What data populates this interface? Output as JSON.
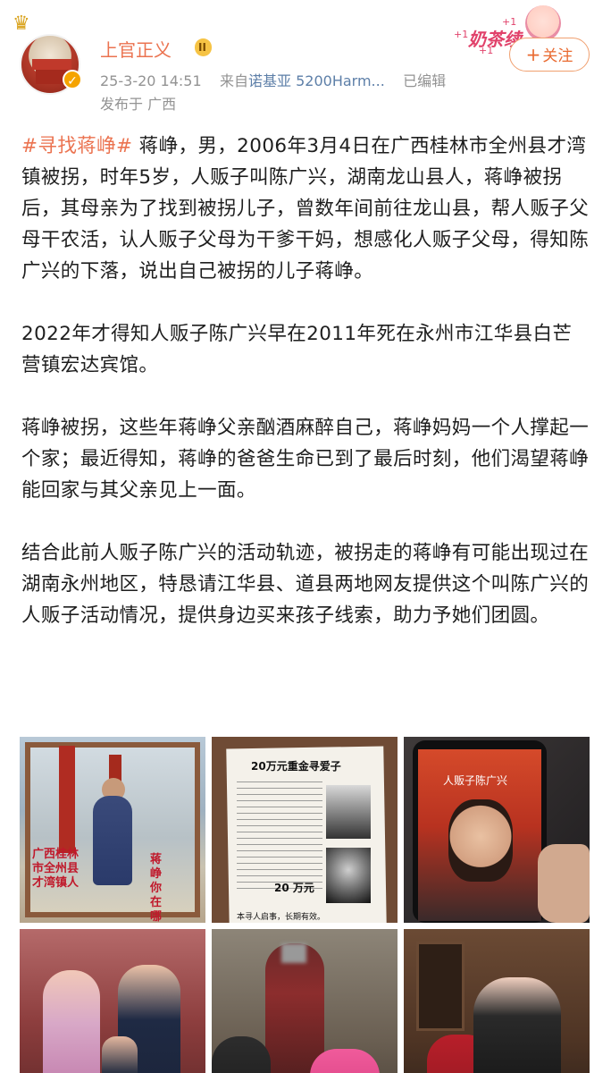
{
  "header": {
    "username": "上官正义",
    "level_badge": "II",
    "timestamp": "25-3-20 14:51",
    "source_prefix": "来自",
    "source_device": "诺基亚 5200Harm...",
    "edited": "已编辑",
    "location": "发布于 广西",
    "sticker_text": "奶茶续",
    "sticker_plus": "+1",
    "follow_label": "关注",
    "follow_plus": "+"
  },
  "post": {
    "hashtag": "#寻找蒋峥#",
    "p1": " 蒋峥，男，2006年3月4日在广西桂林市全州县才湾镇被拐，时年5岁，人贩子叫陈广兴，湖南龙山县人，蒋峥被拐后，其母亲为了找到被拐儿子，曾数年间前往龙山县，帮人贩子父母干农活，认人贩子父母为干爹干妈，想感化人贩子父母，得知陈广兴的下落，说出自己被拐的儿子蒋峥。",
    "p2": "2022年才得知人贩子陈广兴早在2011年死在永州市江华县白芒营镇宏达宾馆。",
    "p3": "蒋峥被拐，这些年蒋峥父亲酗酒麻醉自己，蒋峥妈妈一个人撑起一个家；最近得知，蒋峥的爸爸生命已到了最后时刻，他们渴望蒋峥能回家与其父亲见上一面。",
    "p4": "结合此前人贩子陈广兴的活动轨迹，被拐走的蒋峥有可能出现过在湖南永州地区，特恳请江华县、道县两地网友提供这个叫陈广兴的人贩子活动情况，提供身边买来孩子线索，助力予她们团圆。"
  },
  "images": [
    {
      "caption_left": "广西桂林市全州县才湾镇人",
      "caption_right": "蒋峥你在哪"
    },
    {
      "title": "20万元重金寻爱子",
      "reward": "20 万元",
      "footer": "本寻人启事，长期有效。"
    },
    {
      "label": "人贩子陈广兴"
    },
    {},
    {},
    {}
  ],
  "colors": {
    "accent": "#eb7350",
    "meta": "#939393",
    "text": "#1e1e1e",
    "follow_border": "#f0a070"
  }
}
